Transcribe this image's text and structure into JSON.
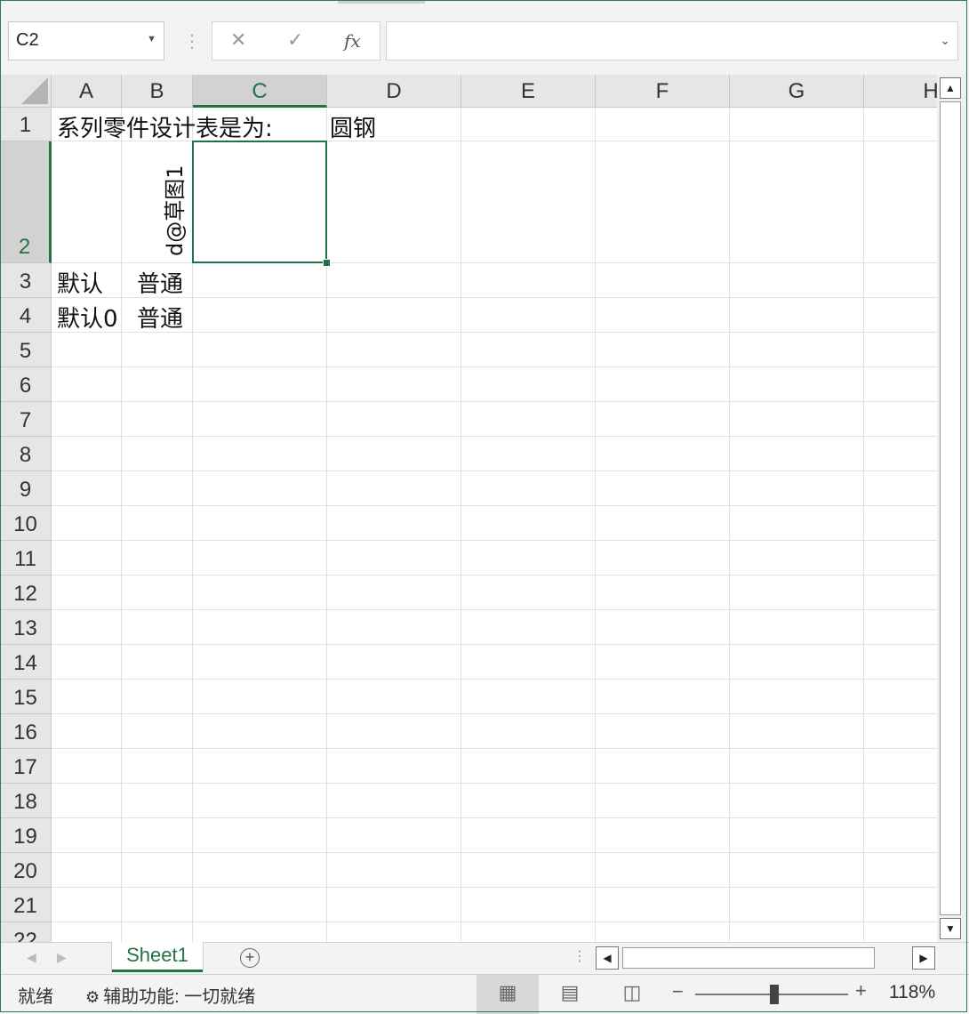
{
  "formula_bar": {
    "name_box": "C2",
    "cancel_icon": "✕",
    "enter_icon": "✓",
    "fx_label": "fx",
    "formula": ""
  },
  "columns": [
    "A",
    "B",
    "C",
    "D",
    "E",
    "F",
    "G",
    "H"
  ],
  "rows": [
    "1",
    "2",
    "3",
    "4",
    "5",
    "6",
    "7",
    "8",
    "9",
    "10",
    "11",
    "12",
    "13",
    "14",
    "15",
    "16",
    "17",
    "18",
    "19",
    "20",
    "21",
    "22"
  ],
  "selected_cell": "C2",
  "cells": {
    "A1": "系列零件设计表是为:",
    "D1": "圆钢",
    "B2": "d@草图1",
    "A3": "默认",
    "B3": "普通",
    "A4": "默认0",
    "B4": "普通"
  },
  "sheet_tabs": [
    "Sheet1"
  ],
  "status": {
    "ready": "就绪",
    "accessibility": "辅助功能: 一切就绪",
    "zoom": "118%"
  },
  "colors": {
    "accent": "#217346",
    "grid_line": "#e1e1e1",
    "header_bg": "#e6e6e6"
  }
}
